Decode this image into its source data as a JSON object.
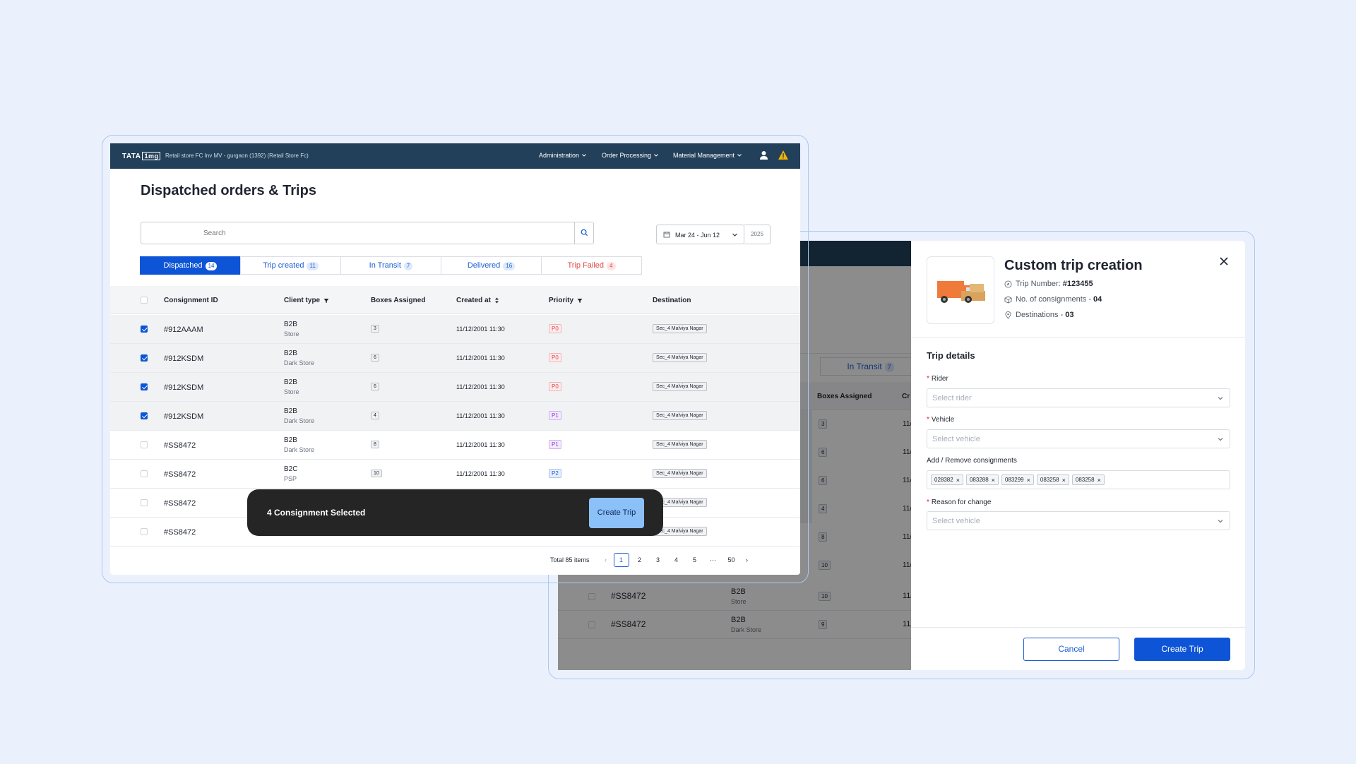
{
  "colors": {
    "brand_blue": "#0d55d6",
    "navbar": "#22405a",
    "toast_bg": "#252525",
    "danger": "#e24b4b"
  },
  "main": {
    "logo": {
      "brand": "TATA",
      "mark": "1mg"
    },
    "store_label": "Retail store FC Inv MV - gurgaon (1392) (Retail Store Fc)",
    "nav": [
      "Administration",
      "Order Processing",
      "Material Management"
    ],
    "page_title": "Dispatched orders & Trips",
    "search_placeholder": "Search",
    "date_range": "Mar 24 - Jun 12",
    "year": "2025",
    "tabs": [
      {
        "label": "Dispatched",
        "count": "14"
      },
      {
        "label": "Trip created",
        "count": "11"
      },
      {
        "label": "In Transit",
        "count": "7"
      },
      {
        "label": "Delivered",
        "count": "16"
      },
      {
        "label": "Trip Failed",
        "count": "4"
      }
    ],
    "columns": [
      "Consignment ID",
      "Client type",
      "Boxes Assigned",
      "Created at",
      "Priority",
      "Destination"
    ],
    "rows": [
      {
        "id": "#912AAAM",
        "type": "B2B",
        "sub": "Store",
        "boxes": "3",
        "created": "11/12/2001 11:30",
        "priority": "P0",
        "dest": "Sec_4 Malviya Nagar",
        "checked": true
      },
      {
        "id": "#912KSDM",
        "type": "B2B",
        "sub": "Dark Store",
        "boxes": "6",
        "created": "11/12/2001 11:30",
        "priority": "P0",
        "dest": "Sec_4 Malviya Nagar",
        "checked": true
      },
      {
        "id": "#912KSDM",
        "type": "B2B",
        "sub": "Store",
        "boxes": "6",
        "created": "11/12/2001 11:30",
        "priority": "P0",
        "dest": "Sec_4 Malviya Nagar",
        "checked": true
      },
      {
        "id": "#912KSDM",
        "type": "B2B",
        "sub": "Dark Store",
        "boxes": "4",
        "created": "11/12/2001 11:30",
        "priority": "P1",
        "dest": "Sec_4 Malviya Nagar",
        "checked": true
      },
      {
        "id": "#SS8472",
        "type": "B2B",
        "sub": "Dark Store",
        "boxes": "8",
        "created": "11/12/2001 11:30",
        "priority": "P1",
        "dest": "Sec_4 Malviya Nagar",
        "checked": false
      },
      {
        "id": "#SS8472",
        "type": "B2C",
        "sub": "PSP",
        "boxes": "10",
        "created": "11/12/2001 11:30",
        "priority": "P2",
        "dest": "Sec_4 Malviya Nagar",
        "checked": false
      },
      {
        "id": "#SS8472",
        "type": "",
        "sub": "",
        "boxes": "",
        "created": "",
        "priority": "",
        "dest": "Sec_4 Malviya Nagar",
        "checked": false
      },
      {
        "id": "#SS8472",
        "type": "",
        "sub": "",
        "boxes": "",
        "created": "",
        "priority": "",
        "dest": "Sec_4 Malviya Nagar",
        "checked": false
      }
    ],
    "pagination": {
      "total": "Total 85 items",
      "pages": [
        "1",
        "2",
        "3",
        "4",
        "5"
      ],
      "ellipsis": "···",
      "last": "50",
      "current": "1"
    },
    "toast": {
      "message": "4 Consignment Selected",
      "button": "Create Trip"
    }
  },
  "background_app": {
    "tab_label": "In Transit",
    "tab_count": "7",
    "columns": [
      "Boxes Assigned",
      "Cr"
    ],
    "box_values": [
      "3",
      "6",
      "6",
      "4",
      "8",
      "10"
    ],
    "cut_date": "11/",
    "rows": [
      {
        "id": "#SS8472",
        "type": "B2B",
        "sub": "Store",
        "boxes": "10",
        "created": "11/"
      },
      {
        "id": "#SS8472",
        "type": "B2B",
        "sub": "Dark Store",
        "boxes": "9",
        "created": "11/"
      }
    ]
  },
  "drawer": {
    "title": "Custom trip creation",
    "trip_number_label": "Trip Number:",
    "trip_number": "#123455",
    "consignments_label": "No. of consignments -",
    "consignments": "04",
    "destinations_label": "Destinations -",
    "destinations": "03",
    "section": "Trip details",
    "rider_label": "Rider",
    "rider_placeholder": "Select rider",
    "vehicle_label": "Vehicle",
    "vehicle_placeholder": "Select vehicle",
    "consignments_field_label": "Add / Remove consignments",
    "chips": [
      "028382",
      "083288",
      "083299",
      "083258",
      "083258"
    ],
    "reason_label": "Reason for change",
    "reason_placeholder": "Select vehicle",
    "cancel": "Cancel",
    "create": "Create Trip"
  }
}
